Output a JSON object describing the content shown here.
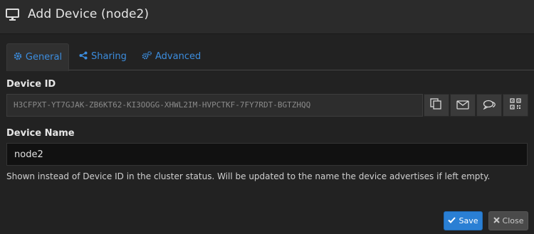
{
  "header": {
    "title": "Add Device (node2)",
    "icon": "monitor-icon"
  },
  "tabs": [
    {
      "label": "General",
      "icon": "gear-icon",
      "active": true
    },
    {
      "label": "Sharing",
      "icon": "share-icon",
      "active": false
    },
    {
      "label": "Advanced",
      "icon": "gears-icon",
      "active": false
    }
  ],
  "device_id": {
    "label": "Device ID",
    "value": "H3CFPXT-YT7GJAK-ZB6KT62-KI3OOGG-XHWL2IM-HVPCTKF-7FY7RDT-BGTZHQQ",
    "actions": [
      "copy-icon",
      "email-icon",
      "share-chat-icon",
      "qr-code-icon"
    ]
  },
  "device_name": {
    "label": "Device Name",
    "value": "node2",
    "help": "Shown instead of Device ID in the cluster status. Will be updated to the name the device advertises if left empty."
  },
  "footer": {
    "save_label": "Save",
    "close_label": "Close"
  },
  "colors": {
    "accent": "#2a7fd4",
    "background": "#222222",
    "header": "#2b2b2b"
  }
}
